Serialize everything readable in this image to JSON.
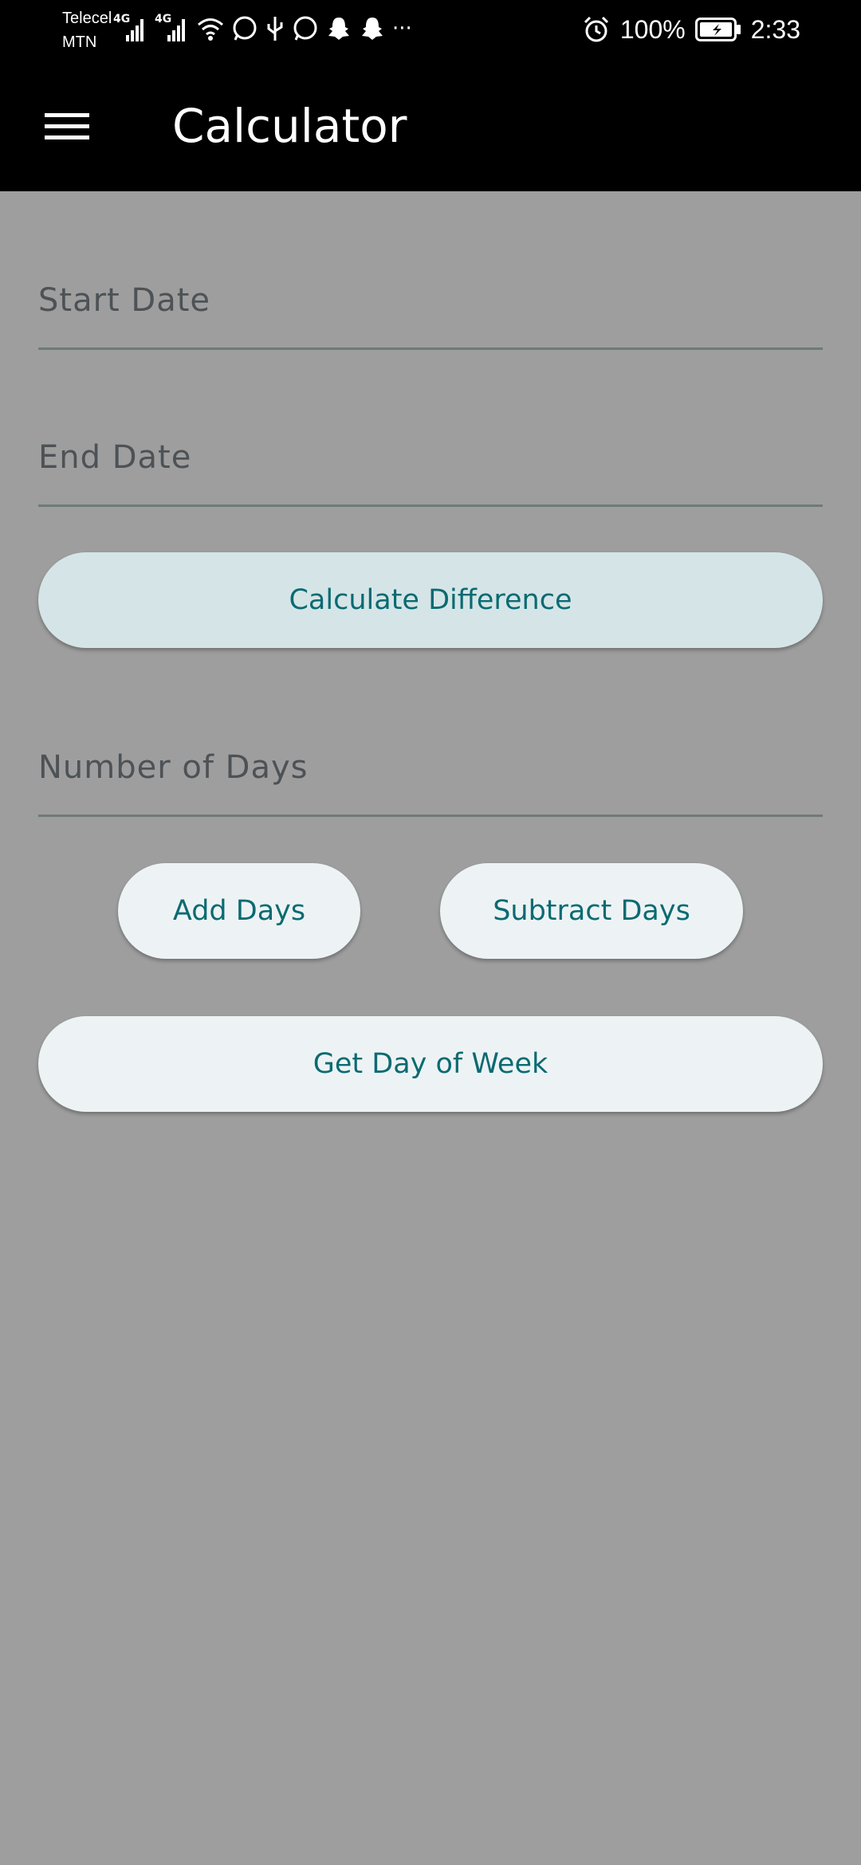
{
  "status_bar": {
    "carrier_1": "Telecel",
    "carrier_2": "MTN",
    "network_1": "4G",
    "network_2": "4G",
    "more": "···",
    "battery": "100%",
    "time": "2:33"
  },
  "app_bar": {
    "title": "Calculator"
  },
  "form": {
    "start_date_placeholder": "Start Date",
    "end_date_placeholder": "End Date",
    "calculate_label": "Calculate Difference",
    "days_placeholder": "Number of Days",
    "add_label": "Add Days",
    "subtract_label": "Subtract Days",
    "weekday_label": "Get Day of Week"
  },
  "colors": {
    "background": "#9e9e9e",
    "app_bar": "#000000",
    "accent_text": "#0b6a72",
    "primary_button": "#d5e5e7",
    "secondary_button": "#edf3f4"
  }
}
